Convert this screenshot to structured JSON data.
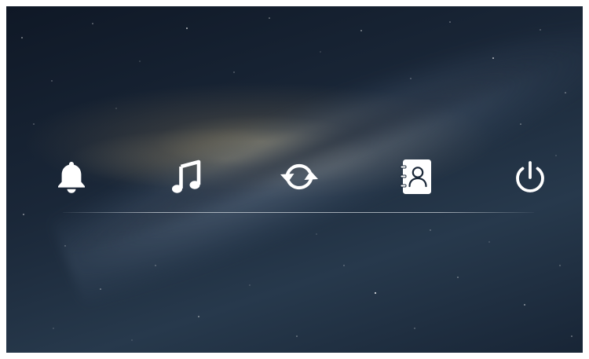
{
  "dock": {
    "items": [
      {
        "icon": "bell-icon",
        "action": "notifications"
      },
      {
        "icon": "music-note-icon",
        "action": "music"
      },
      {
        "icon": "refresh-icon",
        "action": "sync"
      },
      {
        "icon": "contacts-book-icon",
        "action": "contacts"
      },
      {
        "icon": "power-icon",
        "action": "power"
      }
    ]
  },
  "colors": {
    "icon": "#ffffff",
    "divider": "#e1e6eb",
    "sky_dark": "#0f1826",
    "sky_mid": "#27394c",
    "galaxy_glow": "#d7be87"
  }
}
